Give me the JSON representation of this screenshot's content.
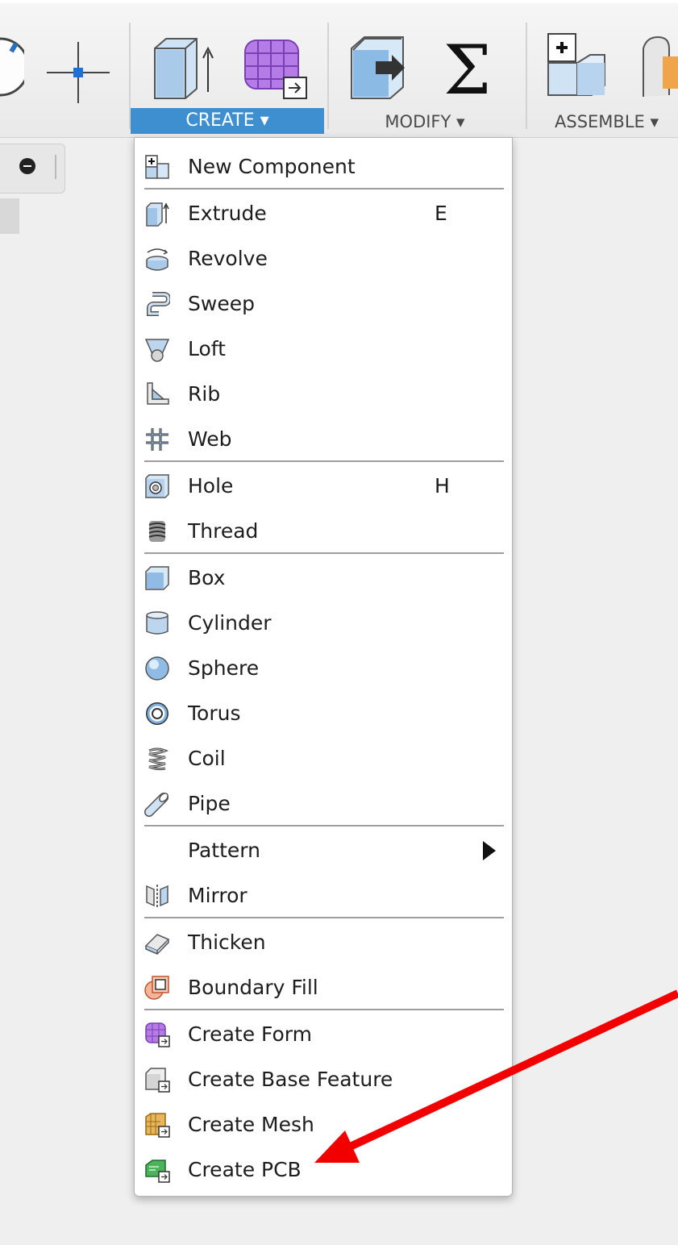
{
  "toolbar": {
    "groups": {
      "create": "CREATE ▾",
      "modify": "MODIFY ▾",
      "assemble": "ASSEMBLE ▾"
    }
  },
  "menu": {
    "items": [
      {
        "label": "New Component",
        "icon": "new-component-icon"
      },
      {
        "label": "Extrude",
        "shortcut": "E",
        "icon": "extrude-icon"
      },
      {
        "label": "Revolve",
        "icon": "revolve-icon"
      },
      {
        "label": "Sweep",
        "icon": "sweep-icon"
      },
      {
        "label": "Loft",
        "icon": "loft-icon"
      },
      {
        "label": "Rib",
        "icon": "rib-icon"
      },
      {
        "label": "Web",
        "icon": "web-icon"
      },
      {
        "label": "Hole",
        "shortcut": "H",
        "icon": "hole-icon"
      },
      {
        "label": "Thread",
        "icon": "thread-icon"
      },
      {
        "label": "Box",
        "icon": "box-icon"
      },
      {
        "label": "Cylinder",
        "icon": "cylinder-icon"
      },
      {
        "label": "Sphere",
        "icon": "sphere-icon"
      },
      {
        "label": "Torus",
        "icon": "torus-icon"
      },
      {
        "label": "Coil",
        "icon": "coil-icon"
      },
      {
        "label": "Pipe",
        "icon": "pipe-icon"
      },
      {
        "label": "Pattern",
        "icon": "submenu-arrow-icon"
      },
      {
        "label": "Mirror",
        "icon": "mirror-icon"
      },
      {
        "label": "Thicken",
        "icon": "thicken-icon"
      },
      {
        "label": "Boundary Fill",
        "icon": "boundary-fill-icon"
      },
      {
        "label": "Create Form",
        "icon": "create-form-icon"
      },
      {
        "label": "Create Base Feature",
        "icon": "create-base-feature-icon"
      },
      {
        "label": "Create Mesh",
        "icon": "create-mesh-icon"
      },
      {
        "label": "Create PCB",
        "icon": "create-pcb-icon"
      }
    ]
  },
  "colors": {
    "accent": "#3e8fd0",
    "annotation_arrow": "#f20000"
  }
}
